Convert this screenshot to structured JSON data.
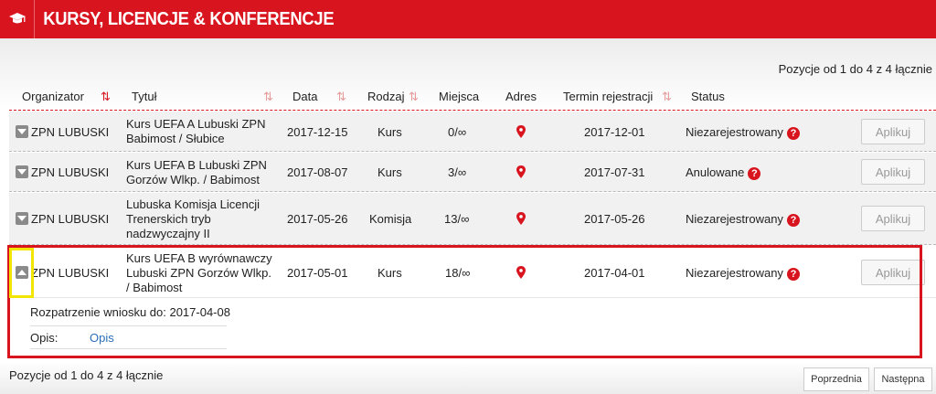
{
  "header": {
    "title": "KURSY, LICENCJE & KONFERENCJE",
    "icon": "graduation-cap-icon"
  },
  "summary": "Pozycje od 1 do 4 z 4 łącznie",
  "columns": [
    "Organizator",
    "Tytuł",
    "Data",
    "Rodzaj",
    "Miejsca",
    "Adres",
    "Termin rejestracji",
    "Status"
  ],
  "rows": [
    {
      "organizer": "ZPN LUBUSKI",
      "title": [
        "Kurs UEFA A Lubuski ZPN",
        "Babimost / Słubice"
      ],
      "date": "2017-12-15",
      "type": "Kurs",
      "places": "0/∞",
      "deadline": "2017-12-01",
      "status": "Niezarejestrowany",
      "action": "Aplikuj"
    },
    {
      "organizer": "ZPN LUBUSKI",
      "title": [
        "Kurs UEFA B Lubuski ZPN",
        "Gorzów Wlkp. / Babimost"
      ],
      "date": "2017-08-07",
      "type": "Kurs",
      "places": "3/∞",
      "deadline": "2017-07-31",
      "status": "Anulowane",
      "action": "Aplikuj"
    },
    {
      "organizer": "ZPN LUBUSKI",
      "title": [
        "Lubuska Komisja Licencji",
        "Trenerskich tryb",
        "nadzwyczajny II"
      ],
      "date": "2017-05-26",
      "type": "Komisja",
      "places": "13/∞",
      "deadline": "2017-05-26",
      "status": "Niezarejestrowany",
      "action": "Aplikuj"
    },
    {
      "organizer": "ZPN LUBUSKI",
      "title": [
        "Kurs UEFA B wyrównawczy",
        "Lubuski ZPN Gorzów Wlkp.",
        "/ Babimost"
      ],
      "date": "2017-05-01",
      "type": "Kurs",
      "places": "18/∞",
      "deadline": "2017-04-01",
      "status": "Niezarejestrowany",
      "action": "Aplikuj"
    }
  ],
  "details": {
    "review": "Rozpatrzenie wniosku do: 2017-04-08",
    "desc_label": "Opis:",
    "desc_link": "Opis"
  },
  "pager": {
    "prev": "Poprzednia",
    "next": "Następna"
  },
  "colors": {
    "brand": "#d8141e",
    "highlight": "#f2e600",
    "link": "#2a6ebb"
  }
}
